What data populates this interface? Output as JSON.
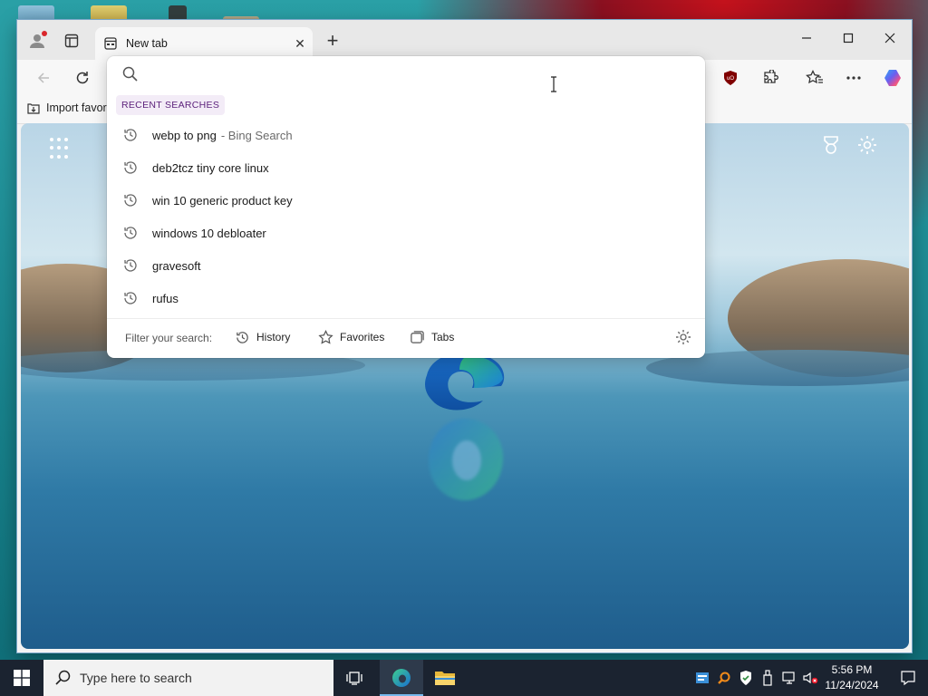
{
  "browser": {
    "tab_title": "New tab",
    "favbar": {
      "import_label": "Import favorites"
    }
  },
  "search": {
    "input_value": "",
    "input_placeholder": "",
    "heading": "RECENT SEARCHES",
    "items": [
      {
        "text": "webp to png",
        "sub": "- Bing Search"
      },
      {
        "text": "deb2tcz tiny core linux",
        "sub": ""
      },
      {
        "text": "win 10 generic product key",
        "sub": ""
      },
      {
        "text": "windows 10 debloater",
        "sub": ""
      },
      {
        "text": "gravesoft",
        "sub": ""
      },
      {
        "text": "rufus",
        "sub": ""
      }
    ],
    "filter_label": "Filter your search:",
    "filters": [
      "History",
      "Favorites",
      "Tabs"
    ]
  },
  "taskbar": {
    "search_placeholder": "Type here to search",
    "time": "5:56 PM",
    "date": "11/24/2024"
  },
  "colors": {
    "accent": "#0078d4",
    "heading_bg": "#f3ecf7",
    "heading_text": "#5a1f7a",
    "taskbar_bg": "#1b2330"
  },
  "icons": [
    "profile-icon",
    "tab-actions-icon",
    "new-tab-page-icon",
    "close-icon",
    "plus-icon",
    "minimize-icon",
    "maximize-icon",
    "window-close-icon",
    "back-icon",
    "refresh-icon",
    "ublock-icon",
    "extensions-icon",
    "favorites-icon",
    "more-icon",
    "copilot-icon",
    "import-icon",
    "apps-grid-icon",
    "rewards-icon",
    "settings-icon",
    "search-icon",
    "history-icon",
    "star-icon",
    "tabs-icon",
    "gear-icon",
    "windows-start-icon",
    "task-view-icon",
    "edge-icon",
    "file-explorer-icon"
  ]
}
